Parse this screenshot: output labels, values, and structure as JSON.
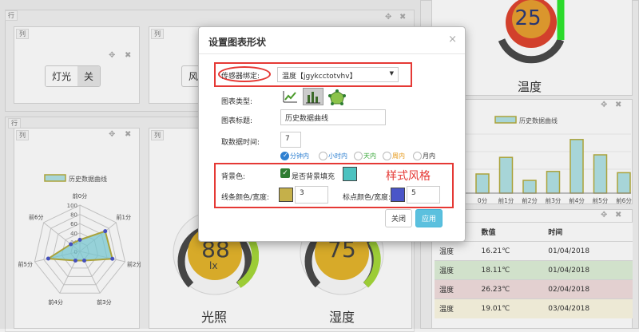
{
  "dashboard": {
    "row_tag": "行",
    "col_tag": "列",
    "move_icon": "✥",
    "close_icon": "✖",
    "light": {
      "label": "灯光",
      "state": "关"
    },
    "partial_label": "风",
    "gauge_temp": {
      "value": "25",
      "caption": "温度"
    },
    "gauge_light": {
      "value": "88",
      "unit": "lx",
      "caption": "光照"
    },
    "gauge_humidity": {
      "value": "75",
      "caption": "湿度"
    },
    "colors": {
      "accent": "#5bc0de",
      "series_fill": "#b2e3e6",
      "series_stroke": "#b5ad3e",
      "point": "#4a55c8"
    }
  },
  "radar": {
    "legend": "历史数据曲线",
    "ticks": [
      "0",
      "20",
      "40",
      "60",
      "80",
      "100"
    ],
    "axes": [
      "前0分",
      "前1分",
      "前2分",
      "前3分",
      "前4分",
      "前5分",
      "前6分"
    ]
  },
  "bar_chart": {
    "legend": "历史数据曲线",
    "categories": [
      "0分",
      "前1分",
      "前2分",
      "前3分",
      "前4分",
      "前5分",
      "前6分"
    ]
  },
  "chart_data": {
    "type": "bar",
    "categories": [
      "前0分",
      "前1分",
      "前2分",
      "前3分",
      "前4分",
      "前5分",
      "前6分"
    ],
    "values": [
      15,
      28,
      10,
      17,
      42,
      30,
      16
    ],
    "legend": "历史数据曲线"
  },
  "radar_data": {
    "type": "radar",
    "values": [
      25,
      70,
      72,
      22,
      22,
      70,
      25
    ],
    "max": 100
  },
  "table": {
    "headers": [
      "",
      "数值",
      "时间"
    ],
    "rows": [
      {
        "name": "温度",
        "value": "16.21℃",
        "time": "01/04/2018",
        "bg": "#ffffff"
      },
      {
        "name": "温度",
        "value": "18.11℃",
        "time": "01/04/2018",
        "bg": "#dff0d8"
      },
      {
        "name": "温度",
        "value": "26.23℃",
        "time": "02/04/2018",
        "bg": "#f2dede"
      },
      {
        "name": "温度",
        "value": "19.01℃",
        "time": "03/04/2018",
        "bg": "#fcf8e3"
      }
    ]
  },
  "modal": {
    "title": "设置图表形状",
    "close": "×",
    "sensor_label": "传感器绑定:",
    "sensor_value": "温度【jgykcctotvhv】",
    "chart_type_label": "图表类型:",
    "chart_title_label": "图表标题:",
    "chart_title_value": "历史数据曲线",
    "time_label": "取数据时间:",
    "time_value": "7",
    "time_units": [
      "分钟内",
      "小时内",
      "天内",
      "周内",
      "月内"
    ],
    "time_unit_colors": [
      "#2f80d1",
      "#2f80d1",
      "#3aa83a",
      "#e69a1c",
      "#333333"
    ],
    "bg_label": "背景色:",
    "fill_label": "是否背景填充",
    "style_note": "样式风格",
    "line_label": "线条颜色/宽度:",
    "line_width": "3",
    "point_label": "标点颜色/宽度:",
    "point_width": "5",
    "close_btn": "关闭",
    "apply_btn": "应用",
    "colors": {
      "bg_swatch": "#4cc2c0",
      "line_swatch": "#c5b04a",
      "point_swatch": "#4a55c8",
      "check": "#2e7d32"
    }
  }
}
